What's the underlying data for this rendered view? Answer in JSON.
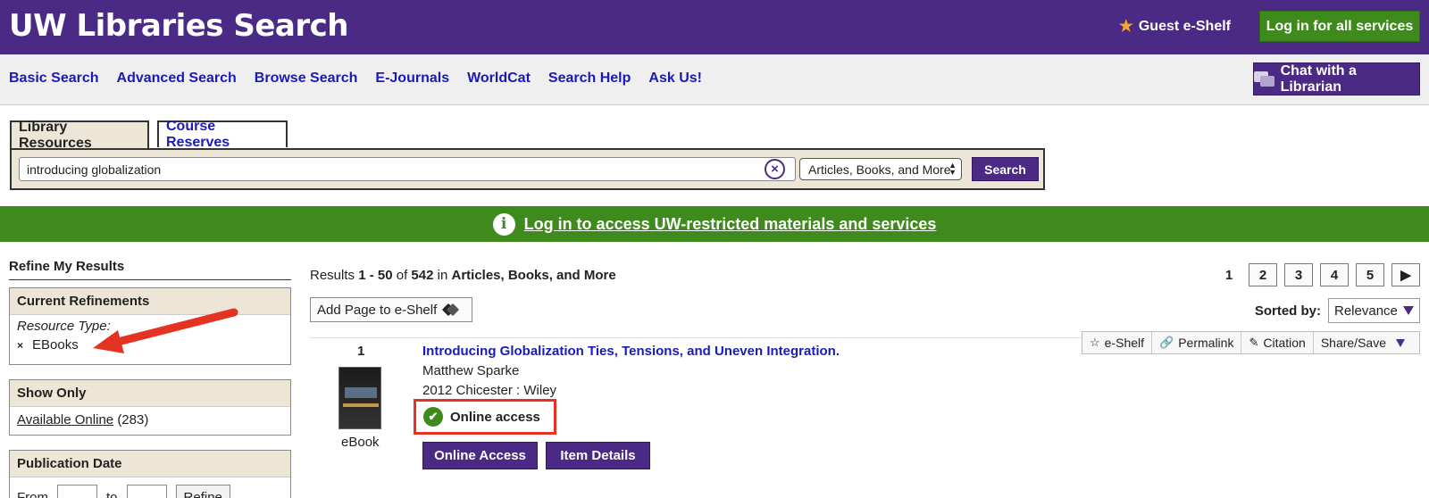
{
  "header": {
    "site_title": "UW Libraries Search",
    "guest_eshelf": "Guest e-Shelf",
    "login_all": "Log in for all services"
  },
  "nav": {
    "links": [
      "Basic Search",
      "Advanced Search",
      "Browse Search",
      "E-Journals",
      "WorldCat",
      "Search Help",
      "Ask Us!"
    ],
    "chat": "Chat with a Librarian"
  },
  "search": {
    "tabs": [
      "Library Resources",
      "Course Reserves"
    ],
    "active_tab": "Library Resources",
    "query": "introducing globalization",
    "scope": "Articles, Books, and More",
    "button": "Search",
    "clear_symbol": "×"
  },
  "banner": {
    "info_symbol": "i",
    "text": "Log in to access UW-restricted materials and services"
  },
  "sidebar": {
    "title": "Refine My Results",
    "current": {
      "heading": "Current Refinements",
      "type_label": "Resource Type:",
      "remove_symbol": "×",
      "value": "EBooks"
    },
    "show_only": {
      "heading": "Show Only",
      "link": "Available Online",
      "count": "(283)"
    },
    "pub_date": {
      "heading": "Publication Date",
      "from": "From",
      "to": "to",
      "refine": "Refine"
    }
  },
  "results": {
    "prefix": "Results",
    "range": "1 - 50",
    "of": "of",
    "total": "542",
    "in": "in",
    "scope": "Articles, Books, and More",
    "add_page": "Add Page to e-Shelf",
    "sorted_label": "Sorted by:",
    "sort_value": "Relevance",
    "pages": {
      "current": "1",
      "others": [
        "2",
        "3",
        "4",
        "5"
      ],
      "next": "▶"
    }
  },
  "record": {
    "number": "1",
    "title": "Introducing Globalization Ties, Tensions, and Uneven Integration.",
    "author": "Matthew Sparke",
    "publication": "2012 Chicester : Wiley",
    "format": "eBook",
    "status": "Online access",
    "buttons": [
      "Online Access",
      "Item Details"
    ],
    "actions": [
      "e-Shelf",
      "Permalink",
      "Citation",
      "Share/Save"
    ]
  },
  "colors": {
    "brand_purple": "#4b2a85",
    "brand_green": "#3e8a1c",
    "link_blue": "#1a1ab8",
    "annotation_red": "#e53323"
  },
  "icons": [
    "star-icon",
    "chat-icon",
    "clear-search-icon",
    "info-icon",
    "tag-icon",
    "check-icon",
    "star-outline-icon",
    "link-icon",
    "pencil-icon",
    "caret-down-icon",
    "next-arrow-icon"
  ]
}
